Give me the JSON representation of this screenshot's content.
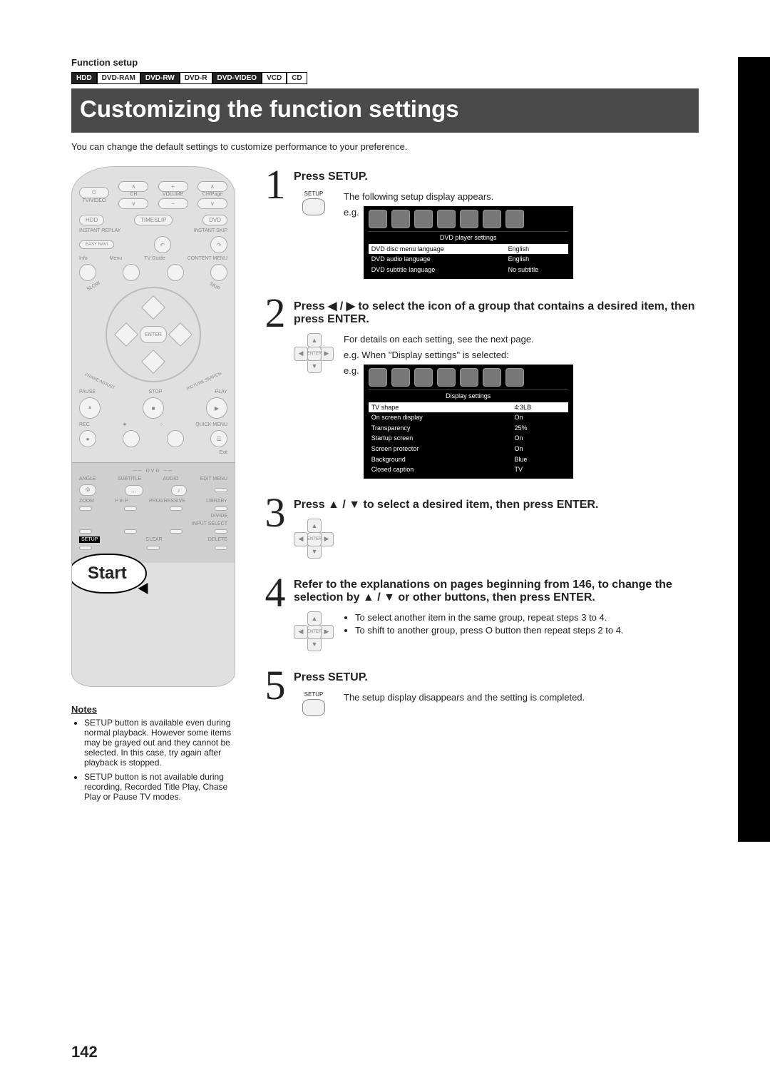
{
  "header": {
    "section_label": "Function setup",
    "chips": [
      "HDD",
      "DVD-RAM",
      "DVD-RW",
      "DVD-R",
      "DVD-VIDEO",
      "VCD",
      "CD"
    ],
    "title": "Customizing the function settings",
    "intro": "You can change the default settings to customize performance to your preference."
  },
  "remote": {
    "top": {
      "tv_video": "TV/VIDEO",
      "ch": "CH",
      "volume": "VOLUME",
      "chpage": "CH/Page"
    },
    "row2": {
      "hdd": "HDD",
      "timeslip": "TIMESLIP",
      "dvd": "DVD"
    },
    "row3": {
      "instant_replay": "INSTANT REPLAY",
      "instant_skip": "INSTANT SKIP",
      "easy_navi": "EASY NAVI"
    },
    "row4": {
      "info": "Info",
      "menu": "Menu",
      "tvguide": "TV Guide",
      "content_menu": "CONTENT MENU"
    },
    "ring": {
      "enter": "ENTER",
      "slow": "SLOW",
      "skip": "SKIP",
      "frame": "FRAME",
      "adjust": "ADJUST",
      "picture": "PICTURE",
      "search": "SEARCH"
    },
    "transport": {
      "pause": "PAUSE",
      "stop": "STOP",
      "play": "PLAY",
      "rec": "REC",
      "quickmenu": "QUICK MENU",
      "exit": "Exit"
    },
    "bottom": {
      "dvd": "DVD",
      "angle": "ANGLE",
      "subtitle": "SUBTITLE",
      "audio": "AUDIO",
      "editmenu": "EDIT MENU",
      "zoom": "ZOOM",
      "pinp": "P in P",
      "progressive": "PROGRESSIVE",
      "library": "LIBRARY",
      "divide": "DIVIDE",
      "inputselect": "INPUT SELECT",
      "setup": "SETUP",
      "clear": "CLEAR",
      "delete": "DELETE"
    },
    "start_label": "Start"
  },
  "notes": {
    "title": "Notes",
    "items": [
      "SETUP button is available even during normal playback. However some items may be grayed out and they cannot be selected. In this case, try again after playback is stopped.",
      "SETUP button is not available during recording, Recorded Title Play, Chase Play or Pause TV modes."
    ]
  },
  "steps": {
    "1": {
      "title": "Press SETUP.",
      "icon_label": "SETUP",
      "lead": "The following setup display appears.",
      "eg": "e.g.",
      "osd_title": "DVD player settings",
      "osd_rows": [
        [
          "DVD disc menu language",
          "English"
        ],
        [
          "DVD audio language",
          "English"
        ],
        [
          "DVD subtitle language",
          "No subtitle"
        ]
      ]
    },
    "2": {
      "title": "Press ◀ / ▶ to select the icon of a group that contains a desired item, then press ENTER.",
      "enter_label": "ENTER",
      "lead": "For details on each setting, see the next page.",
      "eg1": "e.g. When \"Display settings\" is selected:",
      "eg2": "e.g.",
      "osd_title": "Display settings",
      "osd_rows": [
        [
          "TV shape",
          "4:3LB"
        ],
        [
          "On screen display",
          "On"
        ],
        [
          "Transparency",
          "25%"
        ],
        [
          "Startup screen",
          "On"
        ],
        [
          "Screen protector",
          "On"
        ],
        [
          "Background",
          "Blue"
        ],
        [
          "Closed caption",
          "TV"
        ]
      ]
    },
    "3": {
      "title": "Press ▲ / ▼ to select a desired item, then press ENTER.",
      "enter_label": "ENTER"
    },
    "4": {
      "title": "Refer to the explanations on pages beginning from 146, to change the selection by ▲ / ▼ or other buttons, then press ENTER.",
      "enter_label": "ENTER",
      "bullets": [
        "To select another item in the same group, repeat steps 3 to 4.",
        "To shift to another group, press O button then repeat steps 2 to 4."
      ]
    },
    "5": {
      "title": "Press SETUP.",
      "icon_label": "SETUP",
      "lead": "The setup display disappears and the setting is completed."
    }
  },
  "page_number": "142"
}
